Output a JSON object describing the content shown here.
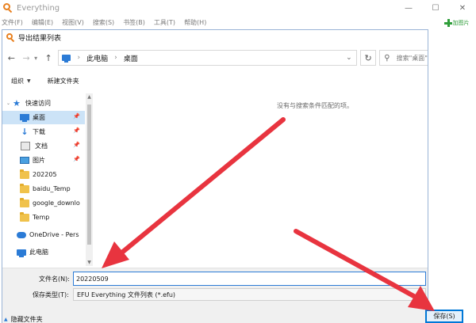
{
  "parent_window": {
    "title": "Everything",
    "menu": [
      "文件(F)",
      "编辑(E)",
      "视图(V)",
      "搜索(S)",
      "书签(B)",
      "工具(T)",
      "帮助(H)"
    ],
    "controls": {
      "minimize": "—",
      "maximize": "☐",
      "close": "✕"
    },
    "side_strip_text": "加图片"
  },
  "dialog": {
    "title": "导出结果列表",
    "address": {
      "root": "此电脑",
      "folder": "桌面"
    },
    "search_placeholder": "搜索\"桌面\"",
    "toolbar": {
      "organize": "组织",
      "new_folder": "新建文件夹"
    },
    "nav": {
      "quick_access": "快速访问",
      "items": [
        {
          "label": "桌面",
          "icon": "desktop-icon",
          "pinned": true,
          "selected": true
        },
        {
          "label": "下载",
          "icon": "download-icon",
          "pinned": true
        },
        {
          "label": "文档",
          "icon": "document-icon",
          "pinned": true
        },
        {
          "label": "图片",
          "icon": "picture-icon",
          "pinned": true
        },
        {
          "label": "202205",
          "icon": "folder-icon"
        },
        {
          "label": "baidu_Temp",
          "icon": "folder-icon"
        },
        {
          "label": "google_downlo",
          "icon": "folder-icon"
        },
        {
          "label": "Temp",
          "icon": "folder-icon"
        }
      ],
      "onedrive": "OneDrive - Pers",
      "this_pc": "此电脑"
    },
    "empty_message": "没有与搜索条件匹配的项。",
    "filename_label": "文件名(N):",
    "filename_value": "20220509",
    "filetype_label": "保存类型(T):",
    "filetype_value": "EFU Everything 文件列表 (*.efu)",
    "hide_folders": "隐藏文件夹",
    "save_button": "保存(S)"
  },
  "colors": {
    "accent": "#2b7bd6",
    "selection": "#cce3f7",
    "arrow": "#e8343f",
    "logo": "#e8801f"
  }
}
